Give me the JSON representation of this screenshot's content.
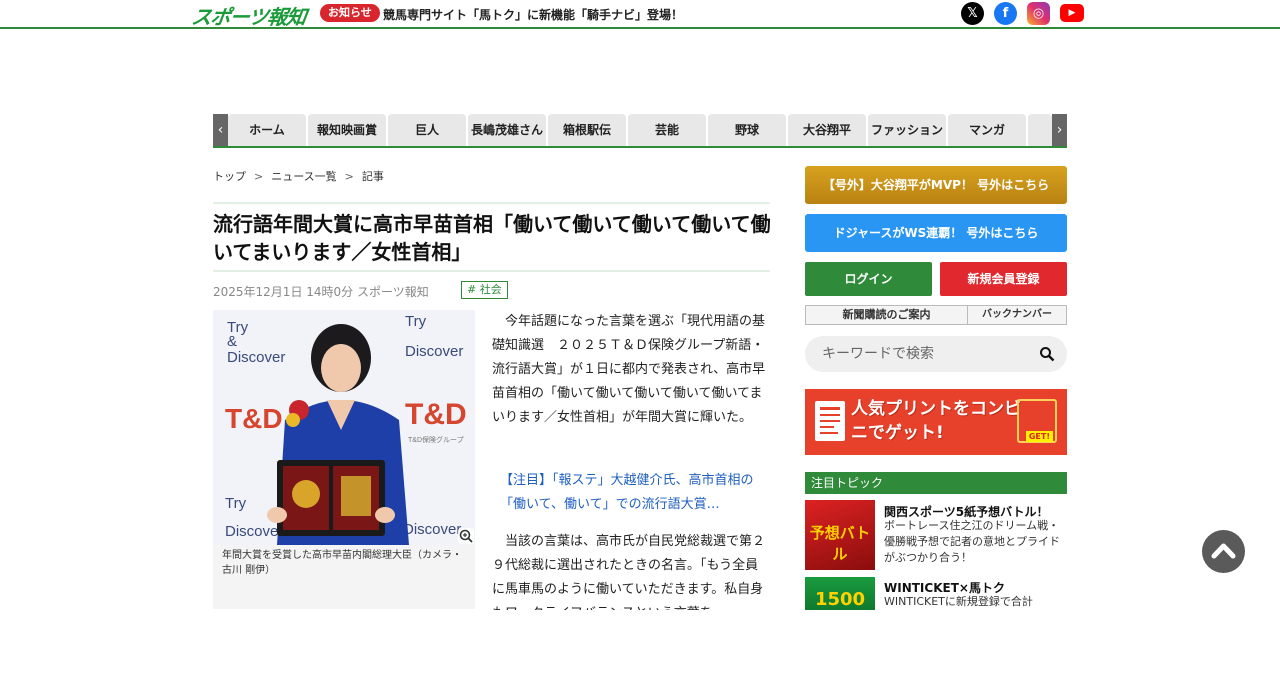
{
  "header": {
    "logo": "スポーツ報知",
    "notice_badge": "お知らせ",
    "notice_text": "競馬専門サイト「馬トク」に新機能「騎手ナビ」登場！",
    "social": [
      "x-icon",
      "facebook-icon",
      "instagram-icon",
      "youtube-icon"
    ]
  },
  "nav": {
    "items": [
      "ホーム",
      "報知映画賞",
      "巨人",
      "長嶋茂雄さん",
      "箱根駅伝",
      "芸能",
      "野球",
      "大谷翔平",
      "ファッション",
      "マンガ",
      ""
    ]
  },
  "breadcrumb": [
    "トップ",
    "ニュース一覧",
    "記事"
  ],
  "article": {
    "headline": "流行語年間大賞に高市早苗首相「働いて働いて働いて働いて働いてまいります／女性首相」",
    "meta": "2025年12月1日 14時0分  スポーツ報知",
    "tag": "# 社会",
    "photo_caption": "年間大賞を受賞した高市早苗内閣総理大臣（カメラ・古川 剛伊）",
    "photo_backdrop": [
      "Try",
      "&",
      "Discover",
      "T&D",
      "T&D保険グループ"
    ],
    "para1": "今年話題になった言葉を選ぶ「現代用語の基礎知識選　２０２５Ｔ＆Ｄ保険グループ新語・流行語大賞」が１日に都内で発表され、高市早苗首相の「働いて働いて働いて働いて働いてまいります／女性首相」が年間大賞に輝いた。",
    "related": "【注目】「報ステ」大越健介氏、高市首相の「働いて、働いて」での流行語大賞…",
    "para2": "当該の言葉は、高市氏が自民党総裁選で第２９代総裁に選出されたときの名言。「もう全員に馬車馬のように働いていただきます。私自身もワークライフバランスという言葉を"
  },
  "sidebar": {
    "gold_button": "【号外】大谷翔平がMVP！ 号外はこちら",
    "blue_button": "ドジャースがWS連覇！ 号外はこちら",
    "login": "ログイン",
    "signup": "新規会員登録",
    "subscribe": "新聞購読のご案内",
    "backnumber": "バックナンバー",
    "search_placeholder": "キーワードで検索",
    "print_banner": "人気プリントをコンビニでゲット!",
    "print_badge": "GET!",
    "topics_header": "注目トピック",
    "topics": [
      {
        "thumb_label": "予想バトル",
        "title": "関西スポーツ5紙予想バトル！",
        "desc": "ボートレース住之江のドリーム戦・優勝戦予想で記者の意地とプライドがぶつかり合う！"
      },
      {
        "thumb_label": "1500",
        "title": "WINTICKET×馬トク",
        "desc": "WINTICKETに新規登録で合計"
      }
    ]
  },
  "colors": {
    "brand_green": "#2f8a3a",
    "alert_red": "#d8262c",
    "link_blue": "#1f5fbf",
    "gold": "#c8921a",
    "sky_blue": "#2996f3"
  }
}
